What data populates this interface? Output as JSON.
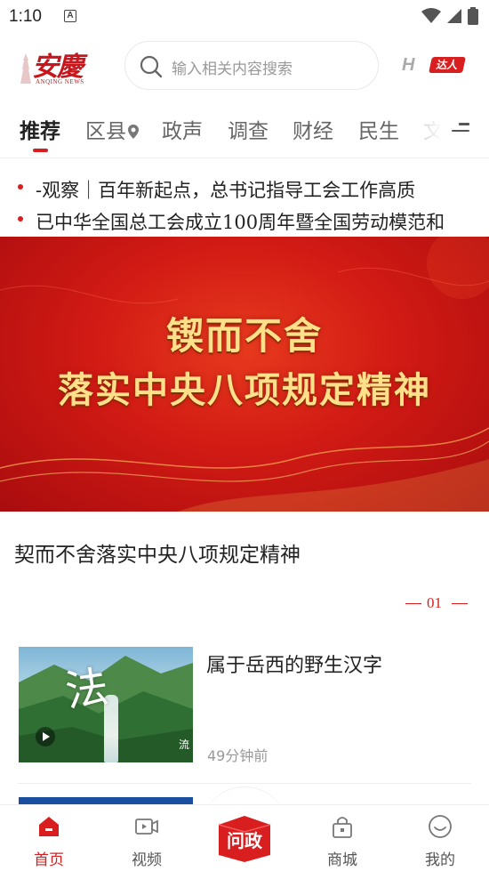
{
  "status_bar": {
    "time": "1:10",
    "indicator": "A",
    "icons": [
      "wifi-icon",
      "signal-icon",
      "battery-icon"
    ]
  },
  "header": {
    "logo_text": "安慶",
    "logo_subtext": "ANQING NEWS",
    "search_placeholder": "输入相关内容搜索",
    "badge_letters": "H",
    "badge_tag": "达人"
  },
  "tabs": [
    {
      "label": "推荐",
      "active": true
    },
    {
      "label": "区县",
      "has_location_icon": true
    },
    {
      "label": "政声"
    },
    {
      "label": "调查"
    },
    {
      "label": "财经"
    },
    {
      "label": "民生"
    },
    {
      "label": "文"
    }
  ],
  "ticker": [
    "-观察｜百年新起点，总书记指导工会工作高质",
    "已中华全国总工会成立100周年暨全国劳动模范和"
  ],
  "banner": {
    "line1": "锲而不舍",
    "line2": "落实中央八项规定精神"
  },
  "featured_title": "契而不舍落实中央八项规定精神",
  "pager": "01",
  "article": {
    "title": "属于岳西的野生汉字",
    "time": "49分钟前",
    "thumb_char": "法",
    "thumb_small": "流"
  },
  "bottom_nav": [
    {
      "label": "首页",
      "icon": "home-icon",
      "active": true
    },
    {
      "label": "视频",
      "icon": "video-icon"
    },
    {
      "label": "问政",
      "icon": "wenzheng-icon",
      "center": true
    },
    {
      "label": "商城",
      "icon": "shop-icon"
    },
    {
      "label": "我的",
      "icon": "profile-icon"
    }
  ],
  "colors": {
    "accent": "#d81e1e",
    "banner_red": "#d11a14",
    "banner_text": "#ffe08a"
  }
}
